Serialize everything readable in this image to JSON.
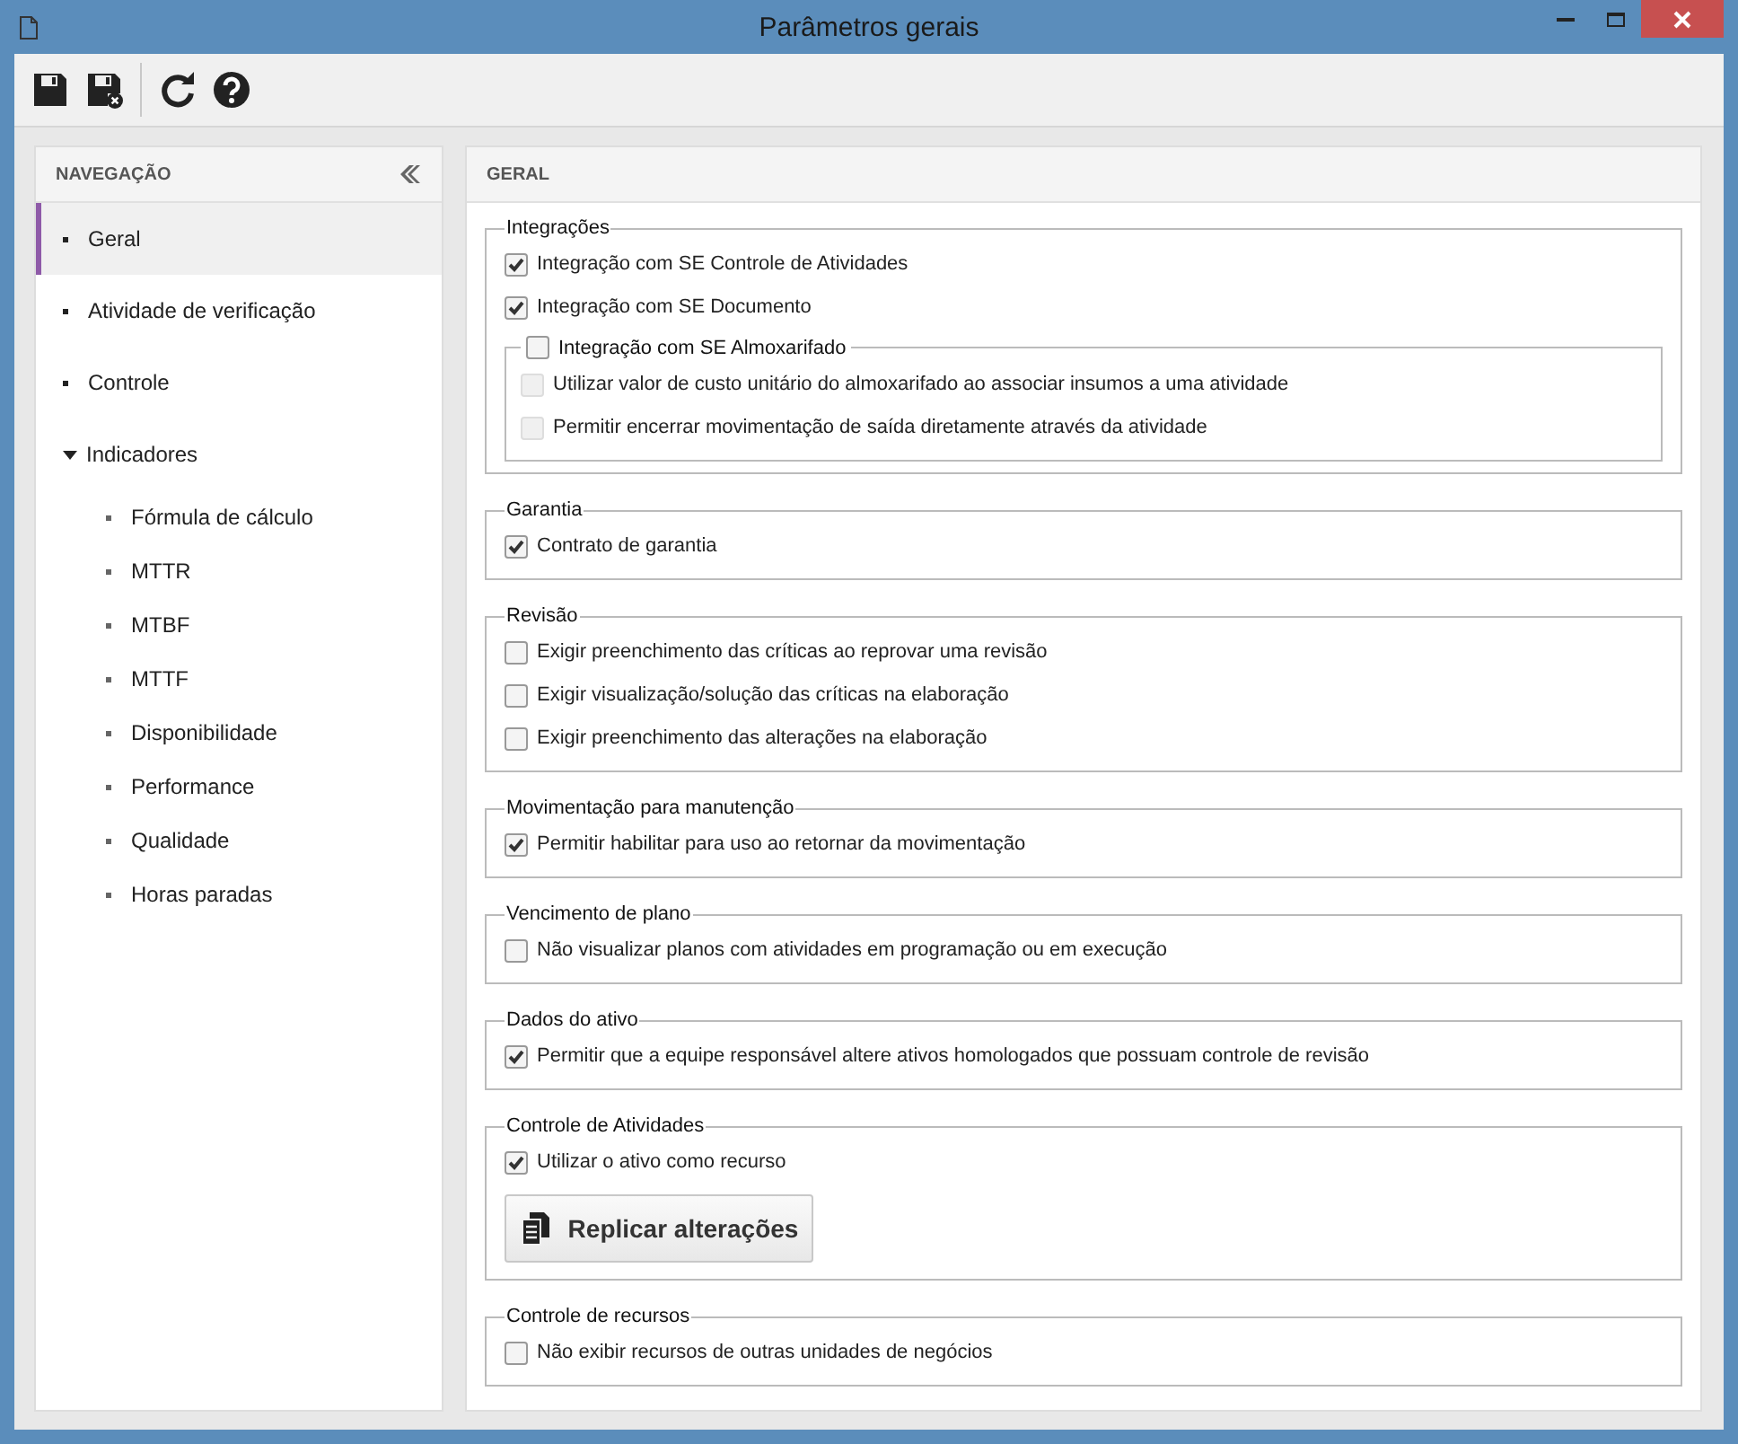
{
  "window": {
    "title": "Parâmetros gerais"
  },
  "navigation": {
    "title": "NAVEGAÇÃO",
    "items": [
      {
        "label": "Geral",
        "selected": true
      },
      {
        "label": "Atividade de verificação",
        "selected": false
      },
      {
        "label": "Controle",
        "selected": false
      },
      {
        "label": "Indicadores",
        "selected": false,
        "expanded": true,
        "children": [
          {
            "label": "Fórmula de cálculo",
            "selected": false
          },
          {
            "label": "MTTR",
            "selected": false
          },
          {
            "label": "MTBF",
            "selected": false
          },
          {
            "label": "MTTF",
            "selected": false
          },
          {
            "label": "Disponibilidade",
            "selected": false
          },
          {
            "label": "Performance",
            "selected": false
          },
          {
            "label": "Qualidade",
            "selected": false
          },
          {
            "label": "Horas paradas",
            "selected": false
          }
        ]
      }
    ]
  },
  "panel": {
    "title": "GERAL",
    "sections": [
      {
        "title": "Integrações",
        "items": [
          {
            "kind": "checkbox",
            "label": "Integração com SE Controle de Atividades",
            "checked": true,
            "disabled": false
          },
          {
            "kind": "checkbox",
            "label": "Integração com SE Documento",
            "checked": true,
            "disabled": false
          },
          {
            "kind": "subgroup",
            "label": "Integração com SE Almoxarifado",
            "checked": false,
            "disabled": false,
            "children": [
              {
                "kind": "checkbox",
                "label": "Utilizar valor de custo unitário do almoxarifado ao associar insumos a uma atividade",
                "checked": false,
                "disabled": true
              },
              {
                "kind": "checkbox",
                "label": "Permitir encerrar movimentação de saída diretamente através da atividade",
                "checked": false,
                "disabled": true
              }
            ]
          }
        ]
      },
      {
        "title": "Garantia",
        "items": [
          {
            "kind": "checkbox",
            "label": "Contrato de garantia",
            "checked": true,
            "disabled": false
          }
        ]
      },
      {
        "title": "Revisão",
        "items": [
          {
            "kind": "checkbox",
            "label": "Exigir preenchimento das críticas ao reprovar uma revisão",
            "checked": false,
            "disabled": false
          },
          {
            "kind": "checkbox",
            "label": "Exigir visualização/solução das críticas na elaboração",
            "checked": false,
            "disabled": false
          },
          {
            "kind": "checkbox",
            "label": "Exigir preenchimento das alterações na elaboração",
            "checked": false,
            "disabled": false
          }
        ]
      },
      {
        "title": "Movimentação para manutenção",
        "items": [
          {
            "kind": "checkbox",
            "label": "Permitir habilitar para uso ao retornar da movimentação",
            "checked": true,
            "disabled": false
          }
        ]
      },
      {
        "title": "Vencimento de plano",
        "items": [
          {
            "kind": "checkbox",
            "label": "Não visualizar planos com atividades em programação ou em execução",
            "checked": false,
            "disabled": false
          }
        ]
      },
      {
        "title": "Dados do ativo",
        "items": [
          {
            "kind": "checkbox",
            "label": "Permitir que a equipe responsável altere ativos homologados que possuam controle de revisão",
            "checked": true,
            "disabled": false
          }
        ]
      },
      {
        "title": "Controle de Atividades",
        "items": [
          {
            "kind": "checkbox",
            "label": "Utilizar o ativo como recurso",
            "checked": true,
            "disabled": false
          },
          {
            "kind": "button",
            "label": "Replicar alterações"
          }
        ]
      },
      {
        "title": "Controle de recursos",
        "items": [
          {
            "kind": "checkbox",
            "label": "Não exibir recursos de outras unidades de negócios",
            "checked": false,
            "disabled": false
          }
        ]
      }
    ]
  }
}
